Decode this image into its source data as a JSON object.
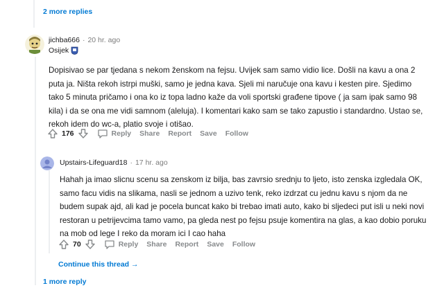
{
  "top": {
    "more_replies": "2 more replies"
  },
  "comment1": {
    "username": "jichba666",
    "separator": "·",
    "time": "20 hr. ago",
    "flair": "Osijek",
    "body": "Dopisivao se par tjedana s nekom ženskom na fejsu. Uvijek sam samo vidio lice. Došli na kavu a ona 2 puta ja. Ništa rekoh istrpi muški, samo je jedna kava. Sjeli mi naručuje ona kavu i kesten pire. Sjedimo tako 5 minuta pričamo i ona ko iz topa ladno kaže da voli sportski građene tipove ( ja sam ipak samo 98 kila) i da se ona me vidi samnom (aleluja). I komentari kako sam se tako zapustio i standardno. Ustao se, rekoh idem do wc-a, platio svoje i otišao.",
    "score": "176",
    "actions": {
      "reply": "Reply",
      "share": "Share",
      "report": "Report",
      "save": "Save",
      "follow": "Follow"
    }
  },
  "comment2": {
    "username": "Upstairs-Lifeguard18",
    "separator": "·",
    "time": "17 hr. ago",
    "body": "Hahah ja imao slicnu scenu sa zenskom iz bilja, bas zavrsio srednju to ljeto, isto zenska izgledala OK, samo facu vidis na slikama, nasli se jednom a uzivo tenk, reko izdrzat cu jednu kavu s njom da ne budem supak ajd, ali kad je pocela buncat kako bi trebao imati auto, kako bi sljedeci put isli u neki novi restoran u petrijevcima tamo vamo, pa gleda nest po fejsu psuje komentira na glas, a kao dobio poruku na mob od lege I reko da moram ici I cao haha",
    "score": "70",
    "actions": {
      "reply": "Reply",
      "share": "Share",
      "report": "Report",
      "save": "Save",
      "follow": "Follow"
    }
  },
  "continue_thread": "Continue this thread",
  "continue_arrow": "→",
  "bottom": {
    "more_replies": "1 more reply"
  },
  "colors": {
    "link": "#0079d3",
    "meta": "#7c7c7c",
    "action": "#878a8c",
    "text": "#1a1a1b",
    "thread_line": "#edeff1"
  }
}
